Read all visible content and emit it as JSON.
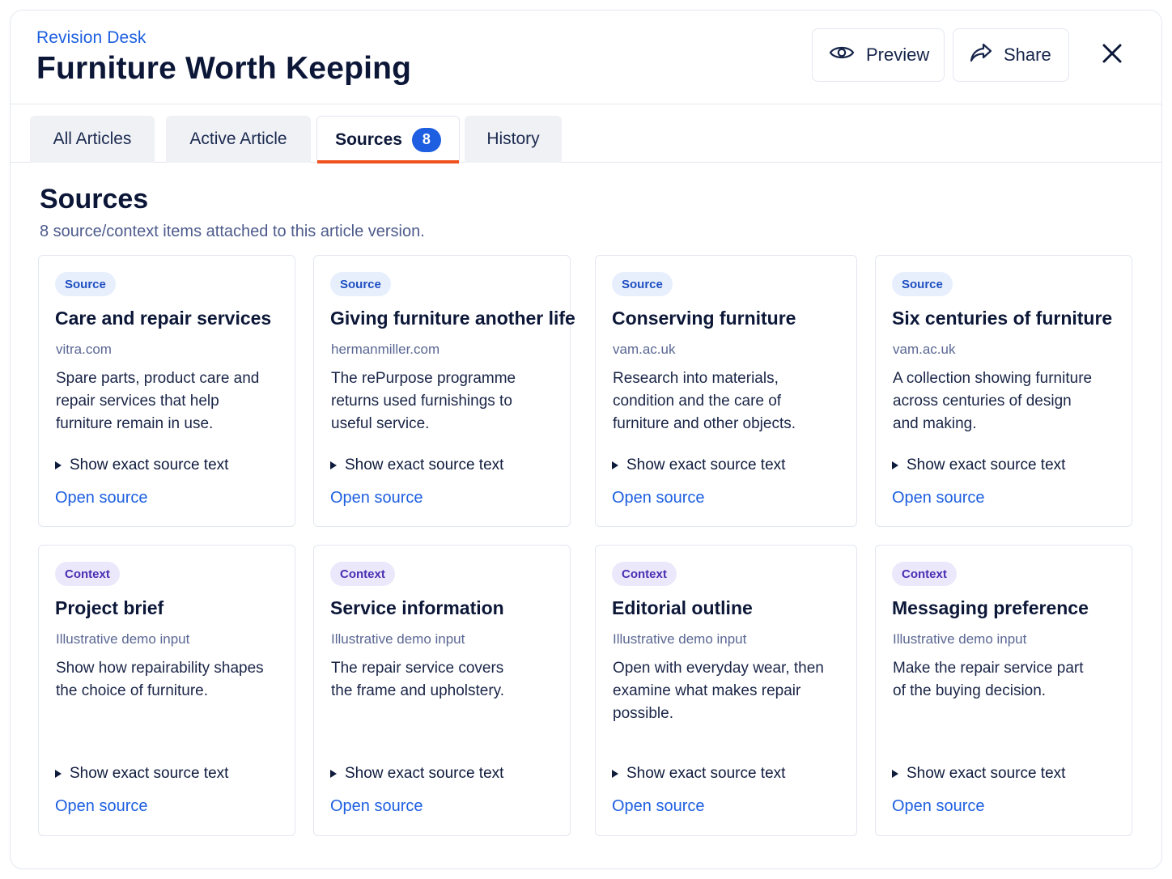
{
  "header": {
    "eyebrow": "Revision Desk",
    "title": "Furniture Worth Keeping",
    "preview_label": "Preview",
    "share_label": "Share",
    "close_icon": "close-icon"
  },
  "tabs": [
    {
      "label": "All Articles"
    },
    {
      "label": "Active Article"
    },
    {
      "label": "Sources",
      "badge": "8",
      "active": true
    },
    {
      "label": "History"
    }
  ],
  "section": {
    "title": "Sources",
    "subtitle": "8 source/context items attached to this article version."
  },
  "cards": [
    {
      "badge": "Source",
      "title": "Care and repair services",
      "domain": "vitra.com",
      "desc": [
        "Spare parts, product care and",
        "repair services that help",
        "furniture remain in use."
      ],
      "show_text": "Show exact source text",
      "open": "Open source"
    },
    {
      "badge": "Source",
      "title": "Giving furniture another life",
      "domain": "hermanmiller.com",
      "desc": [
        "The rePurpose programme",
        "returns used furnishings to",
        "useful service."
      ],
      "show_text": "Show exact source text",
      "open": "Open source"
    },
    {
      "badge": "Source",
      "title": "Conserving furniture",
      "domain": "vam.ac.uk",
      "desc": [
        "Research into materials,",
        "condition and the care of",
        "furniture and other objects."
      ],
      "show_text": "Show exact source text",
      "open": "Open source"
    },
    {
      "badge": "Source",
      "title": "Six centuries of furniture",
      "domain": "vam.ac.uk",
      "desc": [
        "A collection showing furniture",
        "across centuries of design",
        "and making."
      ],
      "show_text": "Show exact source text",
      "open": "Open source"
    },
    {
      "badge": "Context",
      "title": "Project brief",
      "domain": "Illustrative demo input",
      "desc": [
        "Show how repairability shapes",
        "the choice of furniture."
      ],
      "show_text": "Show exact source text",
      "open": "Open source"
    },
    {
      "badge": "Context",
      "title": "Service information",
      "domain": "Illustrative demo input",
      "desc": [
        "The repair service covers",
        "the frame and upholstery."
      ],
      "show_text": "Show exact source text",
      "open": "Open source"
    },
    {
      "badge": "Context",
      "title": "Editorial outline",
      "domain": "Illustrative demo input",
      "desc": [
        "Open with everyday wear, then",
        "examine what makes repair",
        "possible."
      ],
      "show_text": "Show exact source text",
      "open": "Open source"
    },
    {
      "badge": "Context",
      "title": "Messaging preference",
      "domain": "Illustrative demo input",
      "desc": [
        "Make the repair service part",
        "of the buying decision."
      ],
      "show_text": "Show exact source text",
      "open": "Open source"
    }
  ],
  "colors": {
    "accent": "#1d5fe0",
    "active_tab_underline": "#f0521f",
    "source_badge_bg": "#e7effd",
    "context_badge_bg": "#ece8fb"
  }
}
